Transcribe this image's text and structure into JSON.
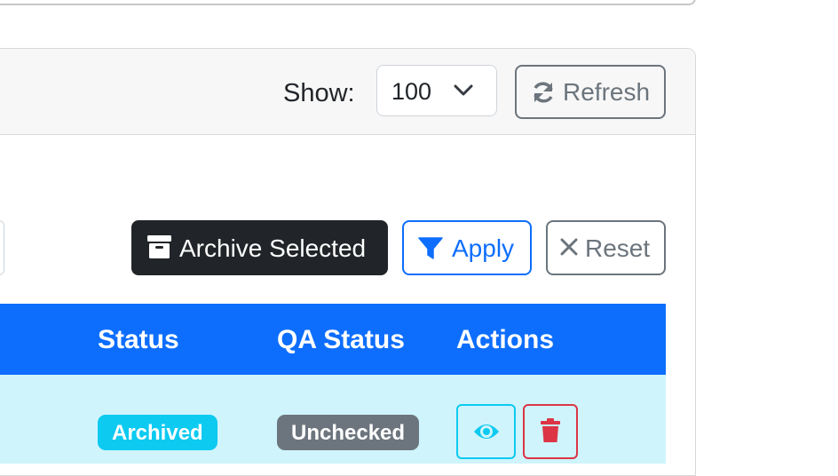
{
  "header": {
    "show_label": "Show:",
    "page_size": "100",
    "refresh_label": "Refresh"
  },
  "toolbar": {
    "archive_label": "Archive Selected",
    "apply_label": "Apply",
    "reset_label": "Reset"
  },
  "table": {
    "columns": [
      "Status",
      "QA Status",
      "Actions"
    ],
    "rows": [
      {
        "status": "Archived",
        "qa_status": "Unchecked"
      }
    ]
  },
  "colors": {
    "primary": "#0d6efd",
    "dark": "#212529",
    "secondary": "#6c757d",
    "info": "#0dcaf0",
    "danger": "#dc3545",
    "row_highlight": "#cff4fc"
  },
  "icons": {
    "refresh": "refresh-icon",
    "archive": "archive-box-icon",
    "filter": "filter-icon",
    "reset": "close-icon",
    "view": "eye-icon",
    "delete": "trash-icon",
    "dropdown": "chevron-down-icon"
  }
}
